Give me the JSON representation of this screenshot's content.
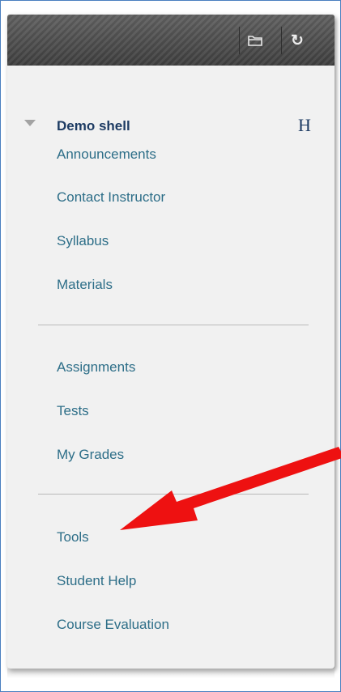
{
  "toolbar": {
    "folder_icon": "folder-icon",
    "refresh_icon": "refresh-icon",
    "refresh_glyph": "↻"
  },
  "course": {
    "title": "Demo shell",
    "edge_letter": "H"
  },
  "menu": {
    "group1": [
      "Announcements",
      "Contact Instructor",
      "Syllabus",
      "Materials"
    ],
    "group2": [
      "Assignments",
      "Tests",
      "My Grades"
    ],
    "group3": [
      "Tools",
      "Student Help",
      "Course Evaluation"
    ]
  },
  "colors": {
    "link": "#2d6e88",
    "title": "#1d3b63",
    "annotation_arrow": "#ee1111"
  }
}
